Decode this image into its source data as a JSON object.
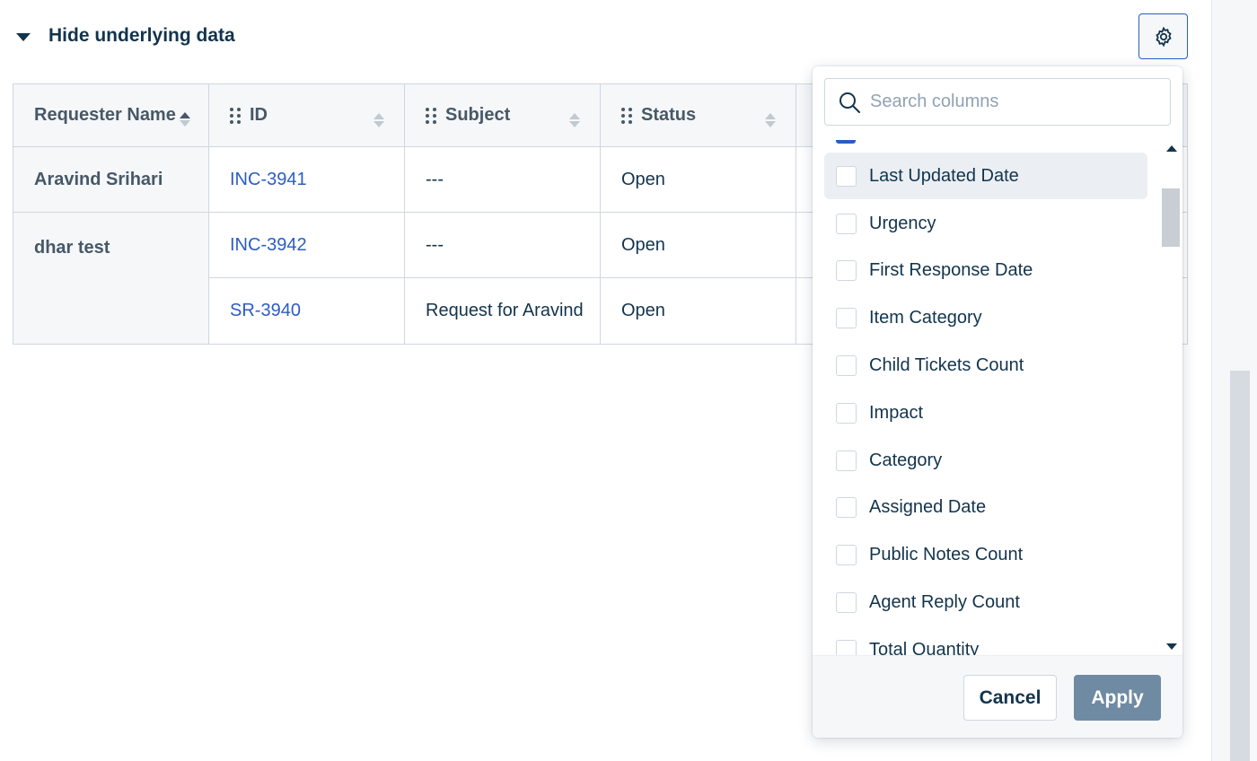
{
  "toggle": {
    "label": "Hide underlying data"
  },
  "settings": {
    "icon": "gear-icon"
  },
  "table": {
    "columns": [
      "Requester Name",
      "ID",
      "Subject",
      "Status"
    ],
    "rows": [
      {
        "requester": "Aravind Srihari",
        "id": "INC-3941",
        "subject": "---",
        "status": "Open"
      },
      {
        "requester": "dhar test",
        "id": "INC-3942",
        "subject": "---",
        "status": "Open"
      },
      {
        "requester": "",
        "id": "SR-3940",
        "subject": "Request for Aravind",
        "status": "Open"
      }
    ]
  },
  "chooser": {
    "search_placeholder": "Search columns",
    "options": [
      "Last Updated Date",
      "Urgency",
      "First Response Date",
      "Item Category",
      "Child Tickets Count",
      "Impact",
      "Category",
      "Assigned Date",
      "Public Notes Count",
      "Agent Reply Count",
      "Total Quantity"
    ],
    "cancel_label": "Cancel",
    "apply_label": "Apply"
  },
  "colors": {
    "link": "#2c5cc5",
    "text": "#12344d",
    "apply_bg": "#6f8aa3"
  }
}
